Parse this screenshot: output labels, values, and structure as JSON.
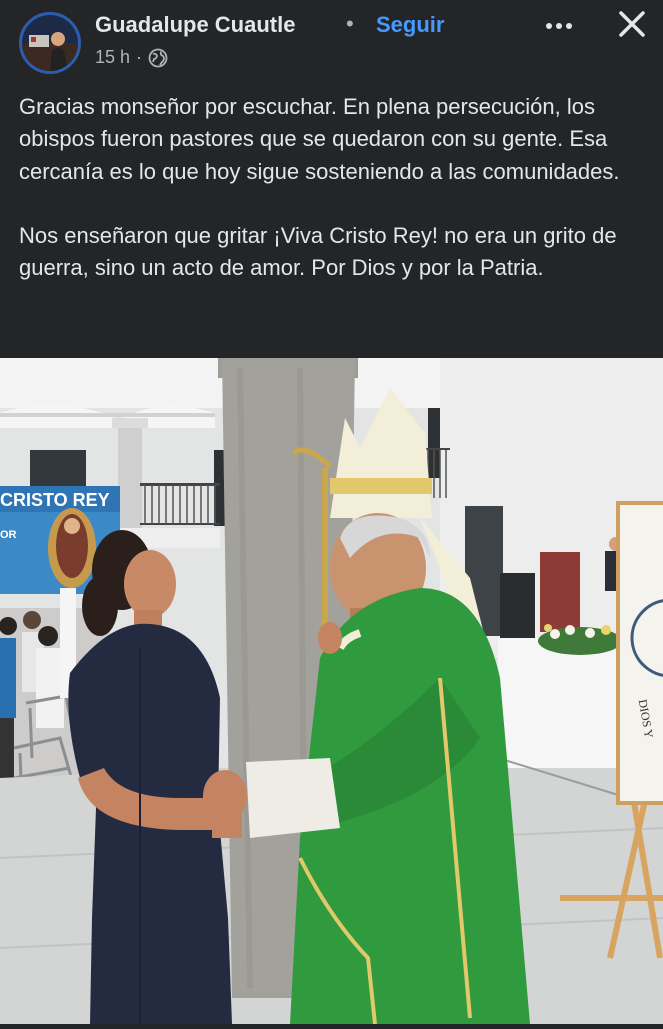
{
  "post": {
    "author": "Guadalupe Cuautle",
    "separator": "•",
    "follow_label": "Seguir",
    "time": "15 h",
    "time_separator": "·",
    "paragraph_1": "Gracias  monseñor por escuchar. En plena persecución, los obispos fueron pastores que se quedaron con su gente. Esa cercanía es lo que hoy sigue sosteniendo a las comunidades.",
    "paragraph_2": "Nos enseñaron que gritar ¡Viva Cristo Rey! no era un grito de guerra, sino un acto de amor. Por Dios y por la Patria."
  },
  "photo": {
    "banner_text": "CRISTO REY",
    "banner_subtext": "OR",
    "easel_text": "DIOS Y"
  },
  "icons": {
    "privacy": "globe-icon",
    "more": "more-horizontal-icon",
    "close": "close-icon"
  },
  "colors": {
    "background": "#242526",
    "text": "#e4e6eb",
    "secondary_text": "#b0b3b8",
    "link": "#4599ff",
    "vestment_green": "#2f9a3e"
  }
}
